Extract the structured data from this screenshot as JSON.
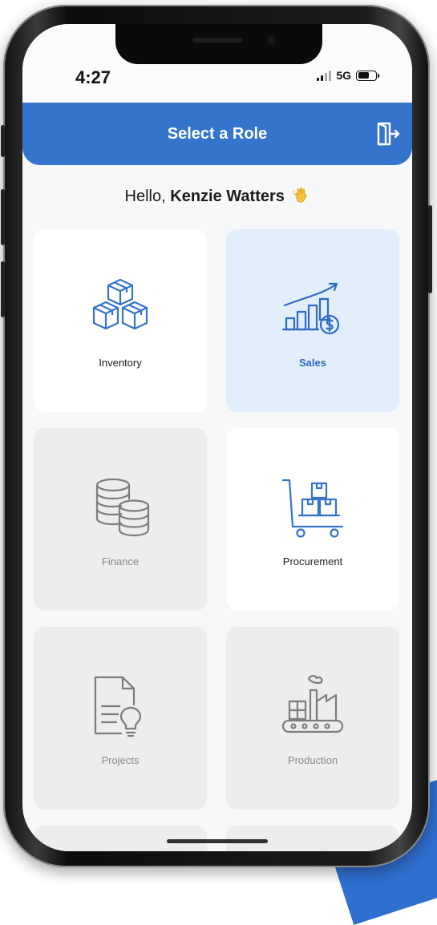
{
  "status": {
    "time": "4:27",
    "network": "5G"
  },
  "header": {
    "title": "Select a Role"
  },
  "greeting": {
    "prefix": "Hello,",
    "name": "Kenzie Watters"
  },
  "roles": [
    {
      "label": "Inventory",
      "state": "available",
      "icon": "boxes-icon"
    },
    {
      "label": "Sales",
      "state": "selected",
      "icon": "sales-chart-icon"
    },
    {
      "label": "Finance",
      "state": "disabled",
      "icon": "coins-icon"
    },
    {
      "label": "Procurement",
      "state": "available",
      "icon": "cart-boxes-icon"
    },
    {
      "label": "Projects",
      "state": "disabled",
      "icon": "document-idea-icon"
    },
    {
      "label": "Production",
      "state": "disabled",
      "icon": "factory-conveyor-icon"
    }
  ],
  "colors": {
    "accent": "#3574cc",
    "selected_tile": "#e2eefb",
    "disabled_tile": "#ededee"
  }
}
